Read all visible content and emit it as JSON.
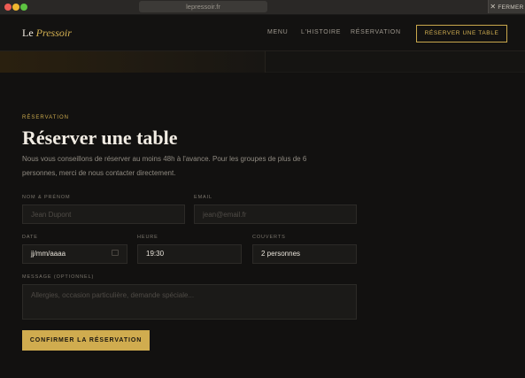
{
  "browser": {
    "url": "lepressoir.fr",
    "close_label": "FERMER"
  },
  "nav": {
    "logo_prefix": "Le",
    "logo_name": "Pressoir",
    "links": [
      "MENU",
      "L'HISTOIRE",
      "RÉSERVATION"
    ],
    "cta": "RÉSERVER UNE TABLE"
  },
  "reservation": {
    "eyebrow": "RÉSERVATION",
    "title": "Réserver une table",
    "intro": "Nous vous conseillons de réserver au moins 48h à l'avance. Pour les groupes de plus de 6 personnes, merci de nous contacter directement.",
    "fields": {
      "name": {
        "label": "NOM & PRÉNOM",
        "placeholder": "Jean Dupont"
      },
      "email": {
        "label": "EMAIL",
        "placeholder": "jean@email.fr"
      },
      "date": {
        "label": "DATE",
        "value": "jj/mm/aaaa"
      },
      "time": {
        "label": "HEURE",
        "value": "19:30"
      },
      "guests": {
        "label": "COUVERTS",
        "value": "2 personnes"
      },
      "message": {
        "label": "MESSAGE (OPTIONNEL)",
        "placeholder": "Allergies, occasion particulière, demande spéciale..."
      }
    },
    "submit": "CONFIRMER LA RÉSERVATION"
  },
  "colors": {
    "accent": "#d0ac4f",
    "background": "#121110"
  },
  "icons": {
    "close": "close-icon",
    "calendar": "calendar-icon"
  }
}
